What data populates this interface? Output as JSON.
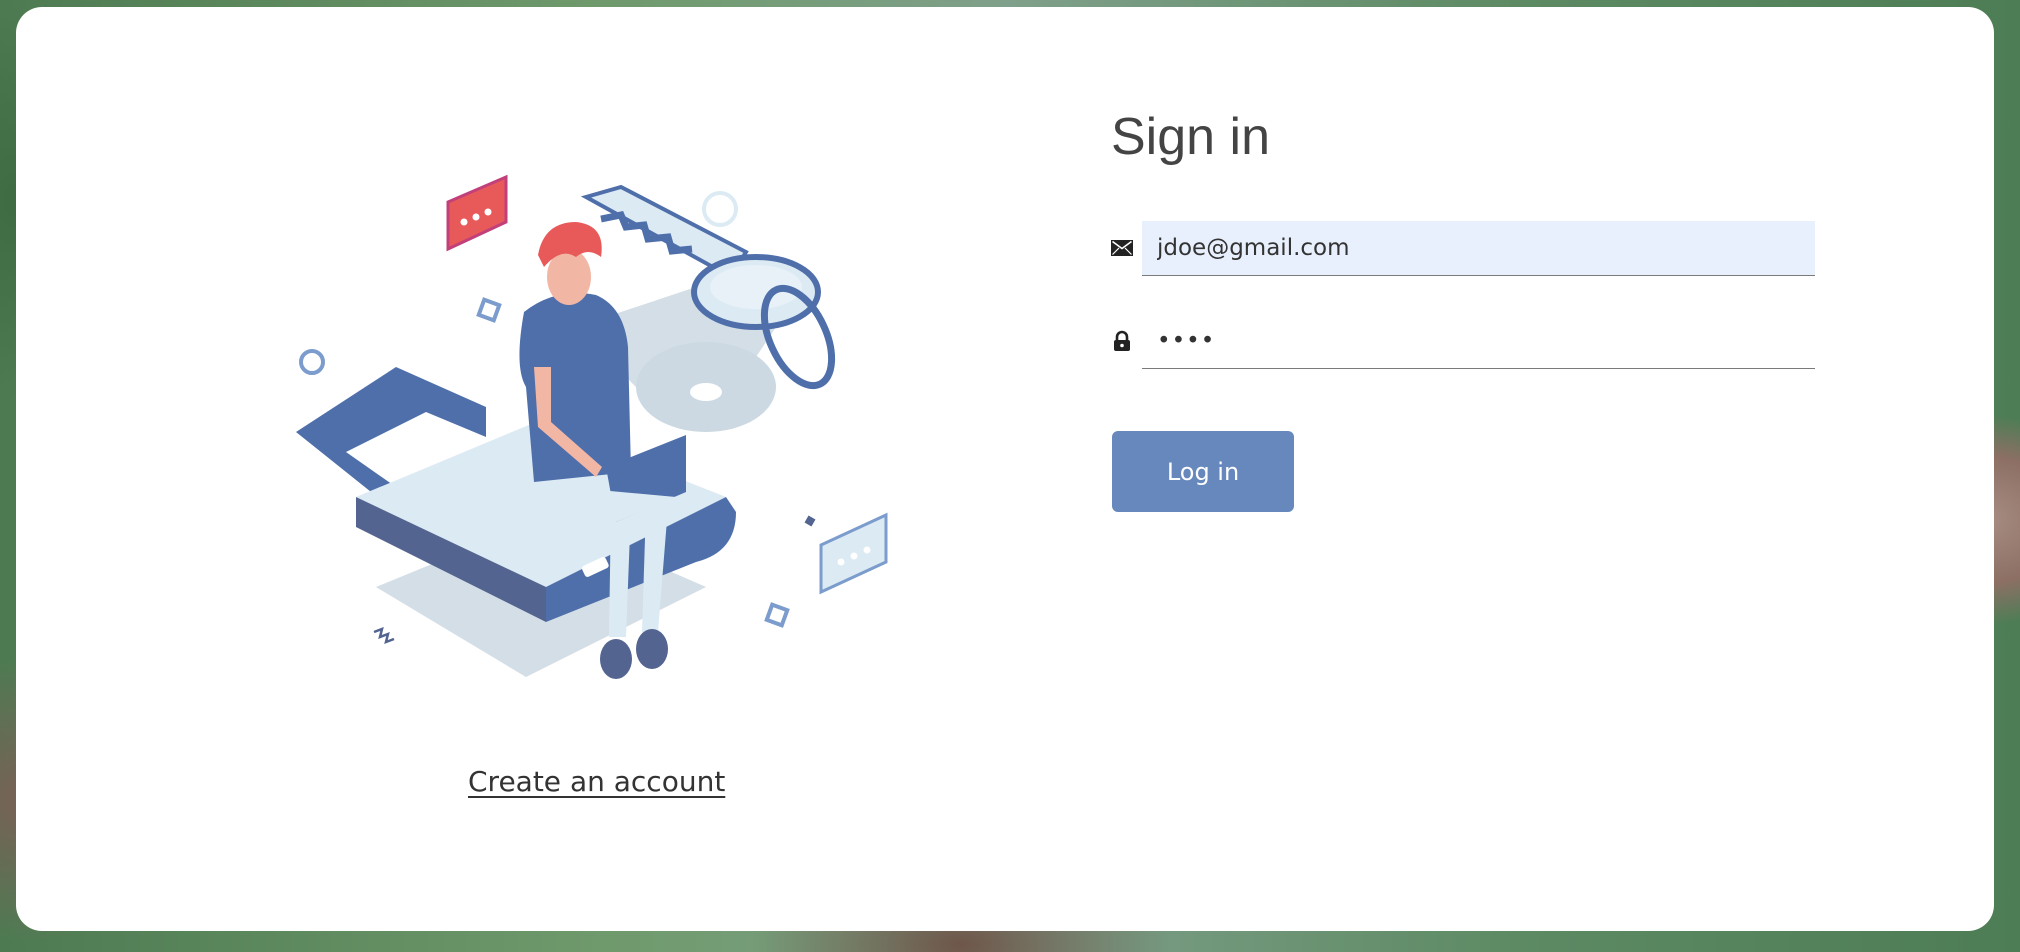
{
  "login": {
    "title": "Sign in",
    "email_value": "jdoe@gmail.com",
    "password_value": "••••",
    "login_button": "Log in",
    "create_account_link": "Create an account"
  },
  "icons": {
    "email": "envelope-icon",
    "password": "lock-icon"
  },
  "colors": {
    "button": "#6688bd",
    "email_field_background": "#e9f0fd",
    "illustration_primary": "#4f6fab",
    "illustration_light": "#dceaf3",
    "illustration_accent": "#e85a5a"
  }
}
